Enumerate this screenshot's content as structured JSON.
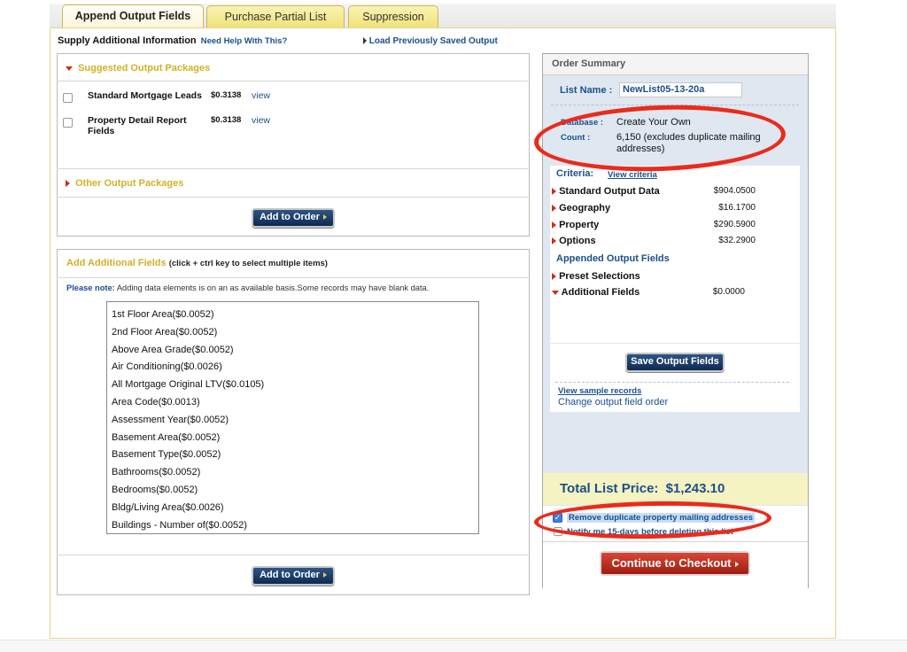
{
  "tabs": [
    {
      "label": "Append Output Fields",
      "active": true
    },
    {
      "label": "Purchase Partial List",
      "active": false
    },
    {
      "label": "Suppression",
      "active": false
    }
  ],
  "header": {
    "supply_info": "Supply Additional Information",
    "help_link": "Need Help With This?",
    "load_saved": "Load Previously Saved Output"
  },
  "suggested": {
    "title": "Suggested Output Packages",
    "items": [
      {
        "name": "Standard Mortgage Leads",
        "price": "$0.3138",
        "view": "view",
        "checked": false
      },
      {
        "name": "Property Detail Report Fields",
        "price": "$0.3138",
        "view": "view",
        "checked": false
      }
    ],
    "other_title": "Other Output Packages",
    "add_button": "Add to Order"
  },
  "additional": {
    "title": "Add Additional Fields",
    "hint": "(click + ctrl key to select multiple items)",
    "note_label": "Please note:",
    "note_text": "Adding data elements is on an as available basis.Some records may have blank data.",
    "fields": [
      "1st Floor Area($0.0052)",
      "2nd Floor Area($0.0052)",
      "Above Area Grade($0.0052)",
      "Air Conditioning($0.0026)",
      "All Mortgage Original LTV($0.0105)",
      "Area Code($0.0013)",
      "Assessment Year($0.0052)",
      "Basement Area($0.0052)",
      "Basement Type($0.0052)",
      "Bathrooms($0.0052)",
      "Bedrooms($0.0052)",
      "Bldg/Living Area($0.0026)",
      "Buildings - Number of($0.0052)"
    ],
    "add_button": "Add to Order"
  },
  "summary": {
    "title": "Order Summary",
    "list_name_label": "List Name :",
    "list_name_value": "NewList05-13-20a",
    "database_label": "Database :",
    "database_value": "Create Your Own",
    "count_label": "Count :",
    "count_value": "6,150 (excludes duplicate mailing addresses)",
    "criteria_label": "Criteria:",
    "view_criteria": "View criteria",
    "criteria": [
      {
        "label": "Standard Output Data",
        "value": "$904.0500"
      },
      {
        "label": "Geography",
        "value": "$16.1700"
      },
      {
        "label": "Property",
        "value": "$290.5900"
      },
      {
        "label": "Options",
        "value": "$32.2900"
      }
    ],
    "appended_label": "Appended Output Fields",
    "preset_label": "Preset Selections",
    "additional_label": "Additional Fields",
    "additional_value": "$0.0000",
    "save_button": "Save Output Fields",
    "view_sample": "View sample records",
    "change_order": "Change output field order",
    "total_label": "Total List Price:",
    "total_value": "$1,243.10",
    "remove_dup_label": "Remove duplicate property mailing addresses",
    "remove_dup_checked": true,
    "notify_label": "Notify me 15-days before deleting this list",
    "notify_checked": false,
    "checkout_button": "Continue to Checkout"
  },
  "colors": {
    "accent_gold": "#d1b226",
    "navy": "#1b4f8c",
    "highlight_red": "#ea2b1b",
    "summary_bg": "#dfe7f1",
    "total_bg": "#f6f3c2"
  }
}
